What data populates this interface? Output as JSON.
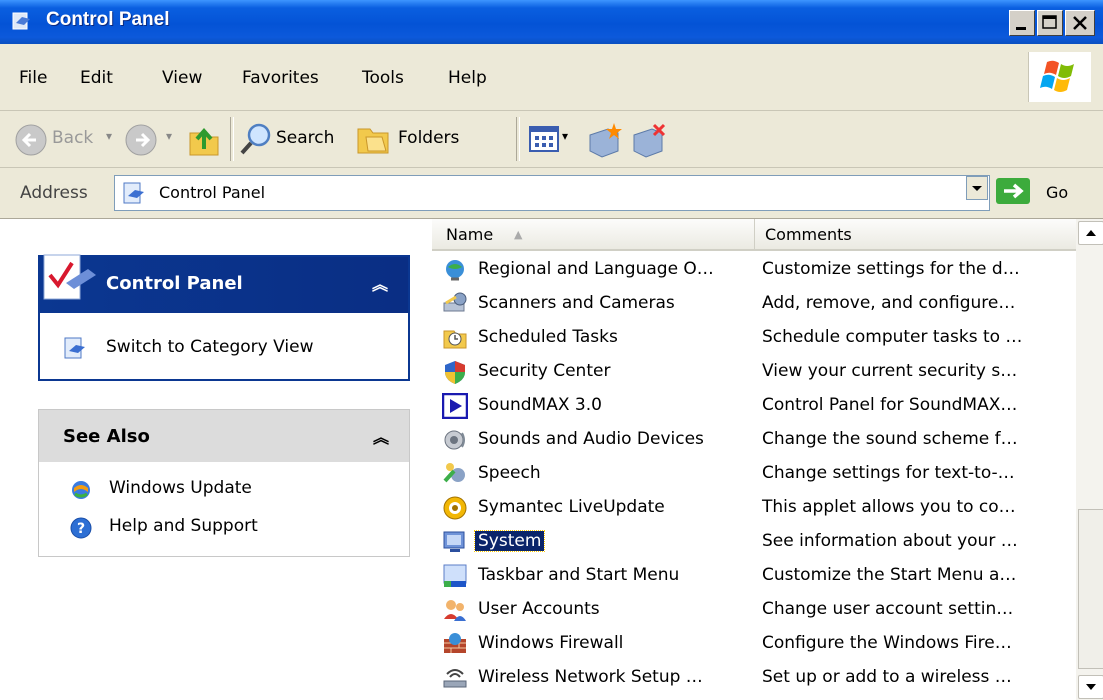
{
  "window": {
    "title": "Control Panel"
  },
  "menu": [
    {
      "label": "File"
    },
    {
      "label": "Edit"
    },
    {
      "label": "View"
    },
    {
      "label": "Favorites"
    },
    {
      "label": "Tools"
    },
    {
      "label": "Help"
    }
  ],
  "toolbar": {
    "back_label": "Back",
    "search_label": "Search",
    "folders_label": "Folders"
  },
  "address": {
    "label": "Address",
    "value": "Control Panel",
    "go_label": "Go"
  },
  "left_pane": {
    "panel1": {
      "title": "Control Panel",
      "link": "Switch to Category View"
    },
    "panel2": {
      "title": "See Also",
      "links": [
        "Windows Update",
        "Help and Support"
      ]
    }
  },
  "columns": {
    "name": "Name",
    "comments": "Comments"
  },
  "items": [
    {
      "name": "Regional and Language O…",
      "comment": "Customize settings for the d…",
      "icon": "globe-icon"
    },
    {
      "name": "Scanners and Cameras",
      "comment": "Add, remove, and configure…",
      "icon": "scanner-icon"
    },
    {
      "name": "Scheduled Tasks",
      "comment": "Schedule computer tasks to …",
      "icon": "folder-clock-icon"
    },
    {
      "name": "Security Center",
      "comment": "View your current security s…",
      "icon": "shield-icon"
    },
    {
      "name": "SoundMAX 3.0",
      "comment": "Control Panel for SoundMAX…",
      "icon": "play-icon"
    },
    {
      "name": "Sounds and Audio Devices",
      "comment": "Change the sound scheme f…",
      "icon": "speaker-icon"
    },
    {
      "name": "Speech",
      "comment": "Change settings for text-to-…",
      "icon": "speech-icon"
    },
    {
      "name": "Symantec LiveUpdate",
      "comment": "This applet allows you to co…",
      "icon": "liveupdate-icon"
    },
    {
      "name": "System",
      "comment": "See information about your …",
      "icon": "system-icon",
      "selected": true
    },
    {
      "name": "Taskbar and Start Menu",
      "comment": "Customize the Start Menu a…",
      "icon": "taskbar-icon"
    },
    {
      "name": "User Accounts",
      "comment": "Change user account settin…",
      "icon": "users-icon"
    },
    {
      "name": "Windows Firewall",
      "comment": "Configure the Windows Fire…",
      "icon": "firewall-icon"
    },
    {
      "name": "Wireless Network Setup …",
      "comment": "Set up or add to a wireless …",
      "icon": "wireless-icon"
    }
  ]
}
